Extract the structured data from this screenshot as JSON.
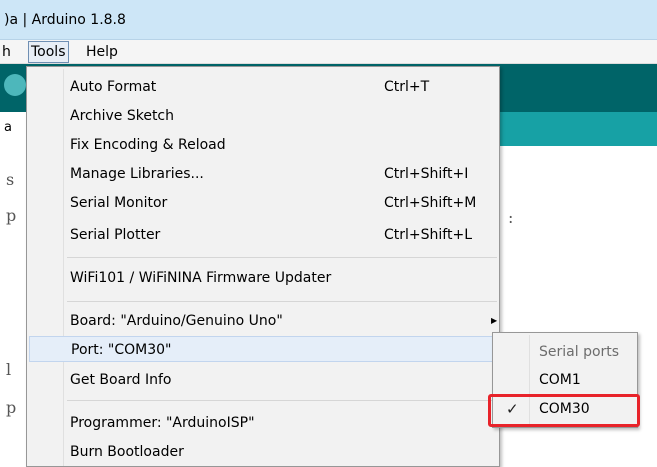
{
  "window": {
    "title": ")a | Arduino 1.8.8"
  },
  "menubar": {
    "items": [
      {
        "label": "h"
      },
      {
        "label": "Tools"
      },
      {
        "label": "Help"
      }
    ]
  },
  "editor": {
    "tab_label": "a",
    "code_fragments": [
      "s",
      "p",
      ":",
      "l",
      "p"
    ]
  },
  "tools_menu": {
    "items": [
      {
        "label": "Auto Format",
        "shortcut": "Ctrl+T"
      },
      {
        "label": "Archive Sketch",
        "shortcut": ""
      },
      {
        "label": "Fix Encoding & Reload",
        "shortcut": ""
      },
      {
        "label": "Manage Libraries...",
        "shortcut": "Ctrl+Shift+I"
      },
      {
        "label": "Serial Monitor",
        "shortcut": "Ctrl+Shift+M"
      },
      {
        "label": "Serial Plotter",
        "shortcut": "Ctrl+Shift+L"
      },
      {
        "label": "WiFi101 / WiFiNINA Firmware Updater",
        "shortcut": ""
      },
      {
        "label": "Board: \"Arduino/Genuino Uno\"",
        "shortcut": ""
      },
      {
        "label": "Port: \"COM30\"",
        "shortcut": ""
      },
      {
        "label": "Get Board Info",
        "shortcut": ""
      },
      {
        "label": "Programmer: \"ArduinoISP\"",
        "shortcut": ""
      },
      {
        "label": "Burn Bootloader",
        "shortcut": ""
      }
    ],
    "submenu_arrow": "▶"
  },
  "port_submenu": {
    "header": "Serial ports",
    "items": [
      {
        "label": "COM1",
        "selected": false
      },
      {
        "label": "COM30",
        "selected": true
      }
    ],
    "check_glyph": "✓"
  },
  "colors": {
    "toolbar": "#006468",
    "tabstrip": "#17a1a5",
    "highlight_box": "#e8232a",
    "menu_background": "#f2f2f2"
  }
}
